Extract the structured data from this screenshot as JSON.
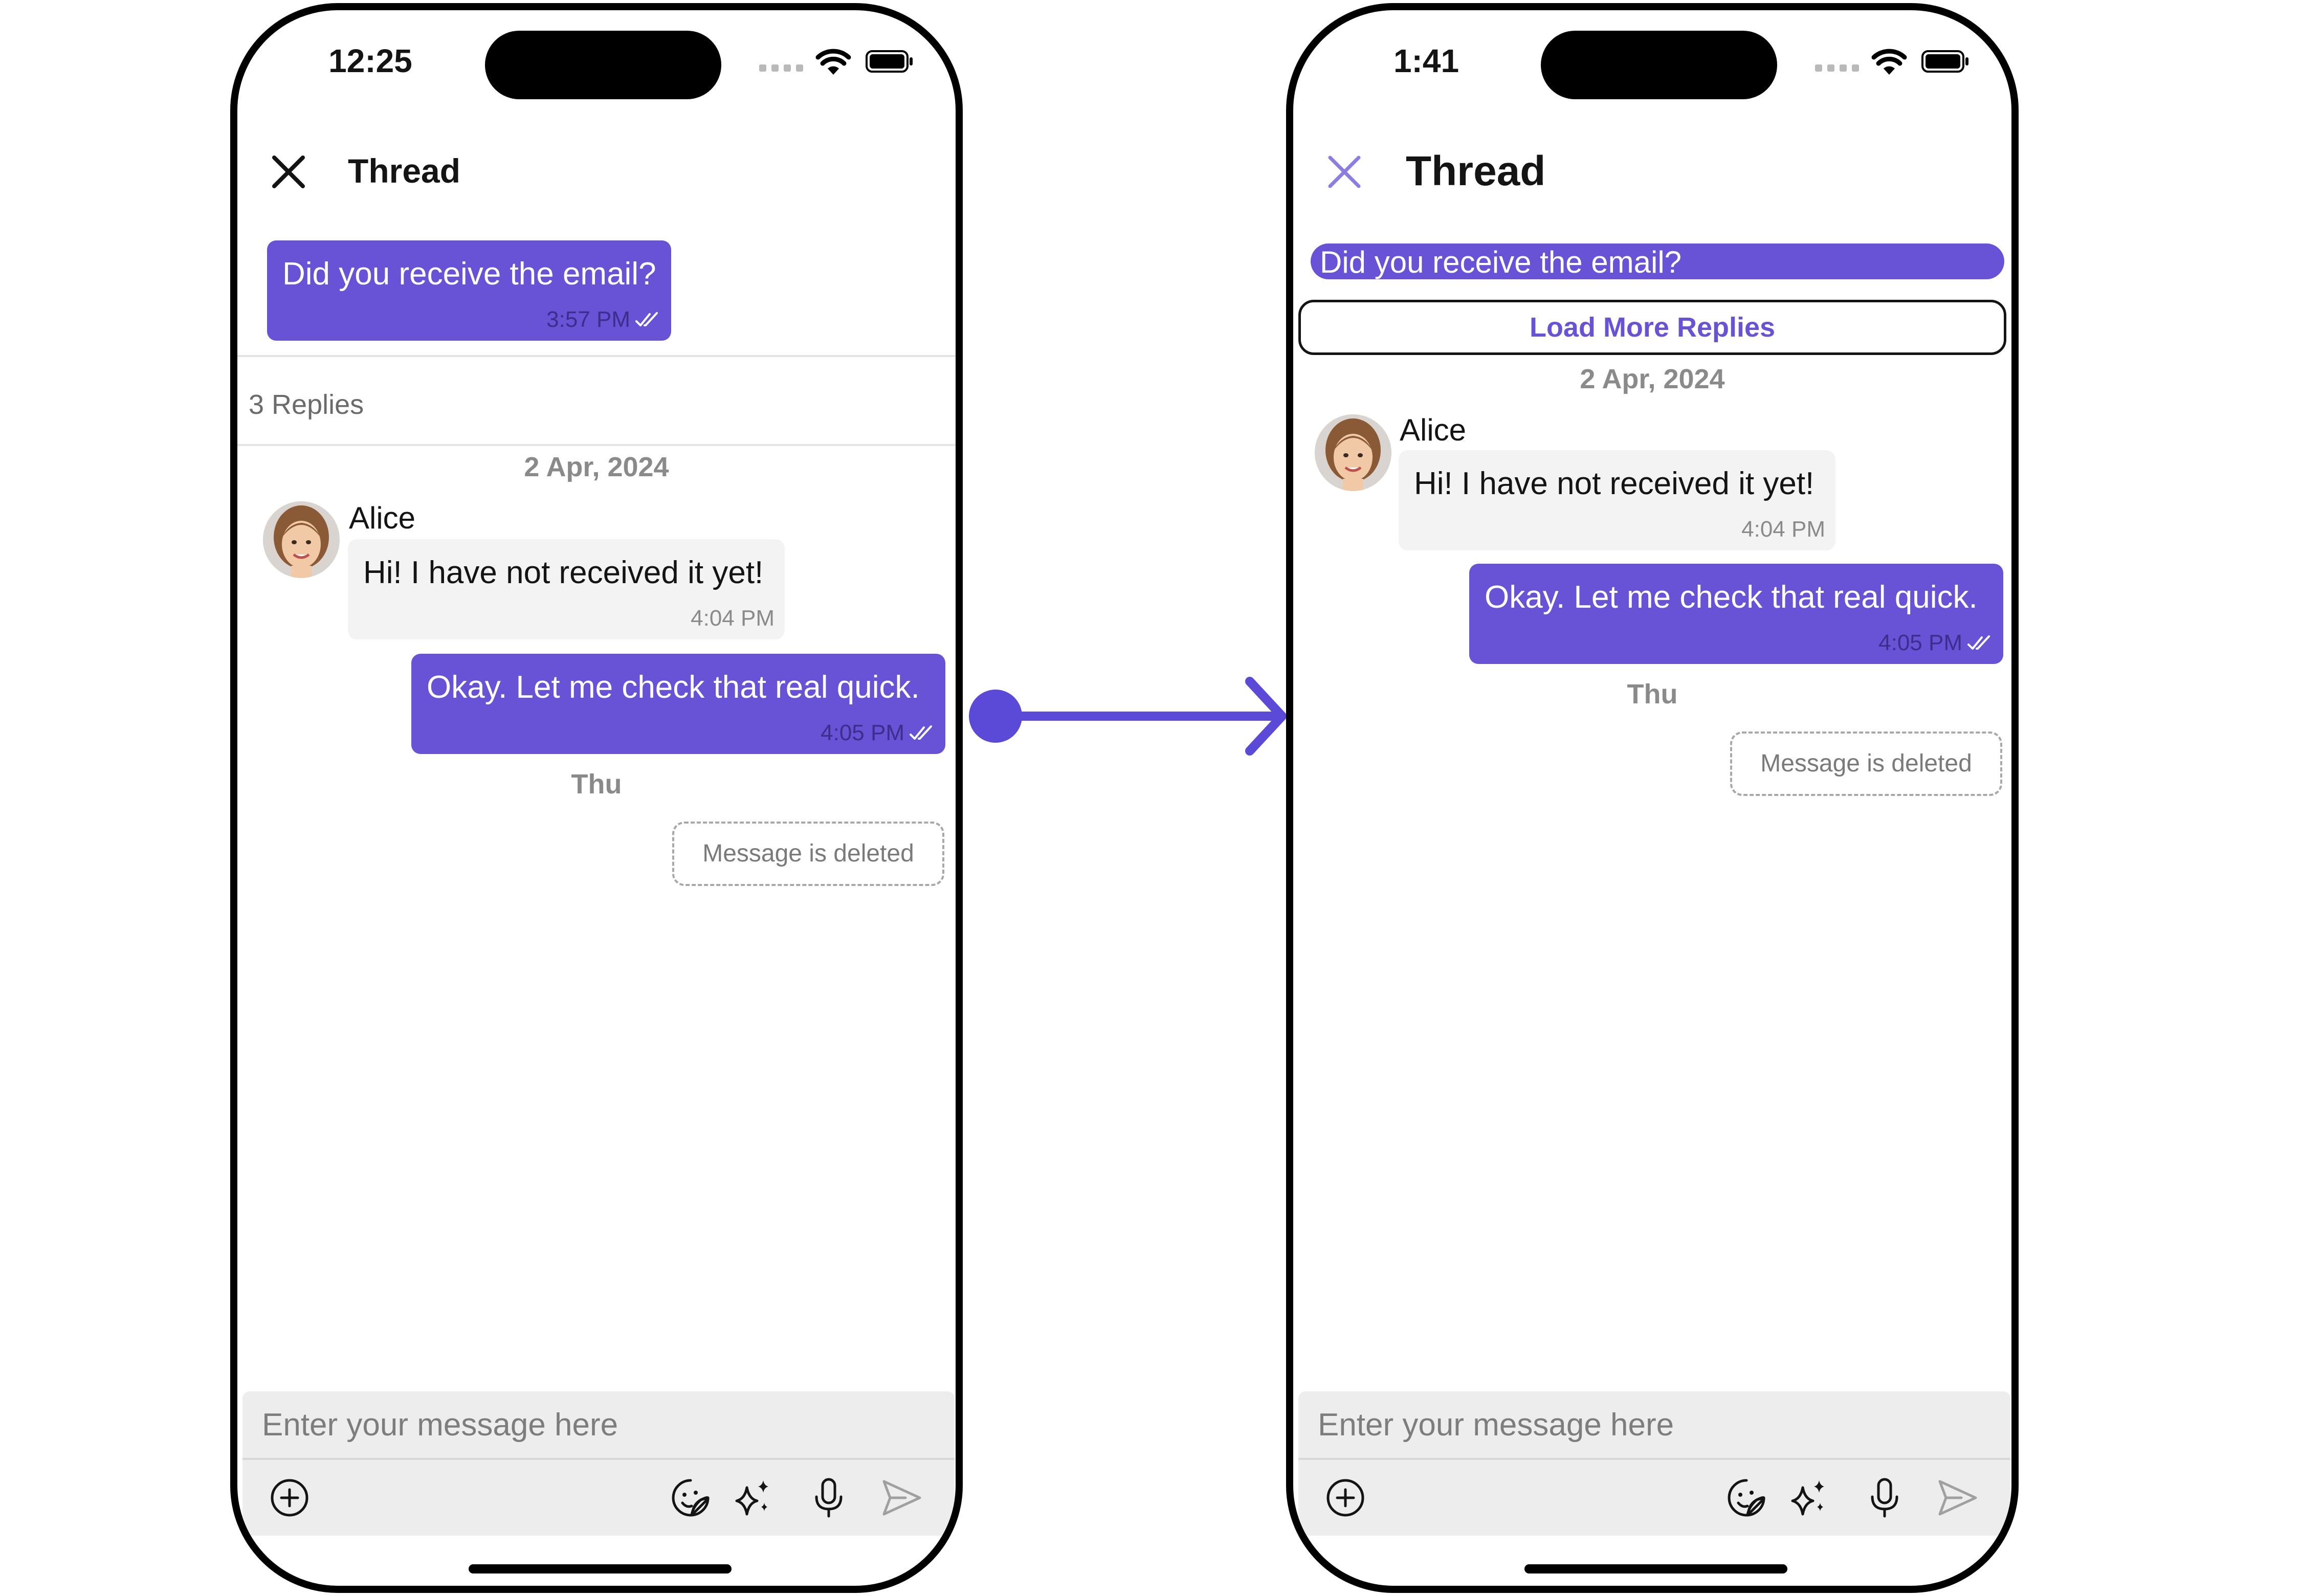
{
  "accent_color": "#6852D6",
  "arrow_color": "#5b4ad8",
  "left_screen": {
    "status_time": "12:25",
    "header_title": "Thread",
    "parent_message": {
      "text": "Did you receive the email?",
      "time": "3:57 PM"
    },
    "replies_count": "3 Replies",
    "date_1": "2 Apr, 2024",
    "incoming": {
      "sender": "Alice",
      "text": "Hi! I have not received it yet!",
      "time": "4:04 PM"
    },
    "outgoing": {
      "text": "Okay. Let me check that real quick.",
      "time": "4:05 PM"
    },
    "date_2": "Thu",
    "deleted_text": "Message is deleted",
    "composer_placeholder": "Enter your message here"
  },
  "right_screen": {
    "status_time": "1:41",
    "header_title": "Thread",
    "parent_message": {
      "text": "Did you receive the email?"
    },
    "load_more_label": "Load More Replies",
    "date_1": "2 Apr, 2024",
    "incoming": {
      "sender": "Alice",
      "text": "Hi! I have not received it yet!",
      "time": "4:04 PM"
    },
    "outgoing": {
      "text": "Okay. Let me check that real quick.",
      "time": "4:05 PM"
    },
    "date_2": "Thu",
    "deleted_text": "Message is deleted",
    "composer_placeholder": "Enter your message here"
  },
  "icons": {
    "close": "close-icon",
    "attach": "plus-circle-icon",
    "sticker": "sticker-icon",
    "ai": "sparkles-icon",
    "mic": "microphone-icon",
    "send": "send-icon",
    "read_receipt": "double-check-icon",
    "signal": "cellular-dots-icon",
    "wifi": "wifi-icon",
    "battery": "battery-icon"
  }
}
